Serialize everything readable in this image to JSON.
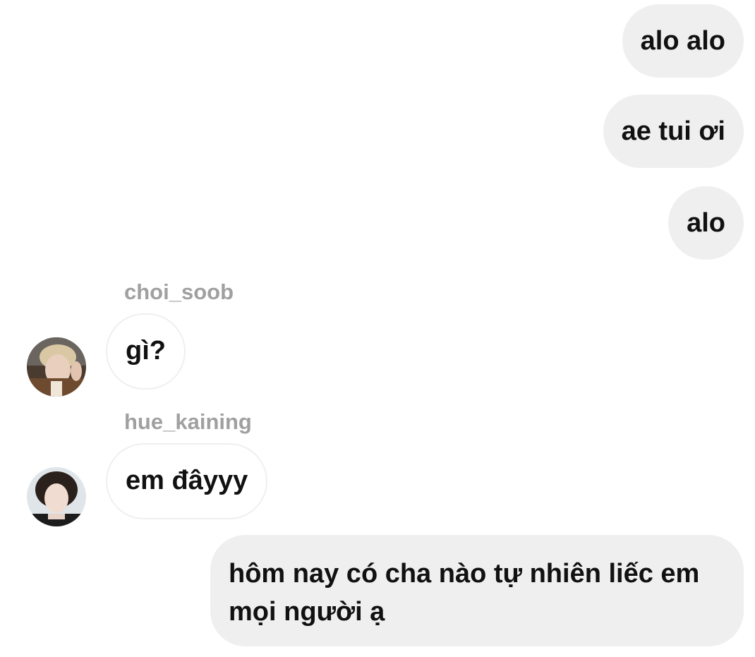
{
  "messages": {
    "m1": "alo alo",
    "m2": "ae tui ơi",
    "m3": "alo",
    "m4_user": "choi_soob",
    "m4": "gì?",
    "m5_user": "hue_kaining",
    "m5": "em đâyyy",
    "m6_line1": "hôm nay có cha nào tự nhiên liếc em",
    "m6_line2": "mọi người ạ"
  },
  "colors": {
    "outgoing_bubble": "#efefef",
    "incoming_border": "#efefef",
    "username": "#a0a0a0",
    "text": "#111111"
  },
  "icons": {
    "avatar_1": "avatar-photo",
    "avatar_2": "avatar-photo"
  }
}
